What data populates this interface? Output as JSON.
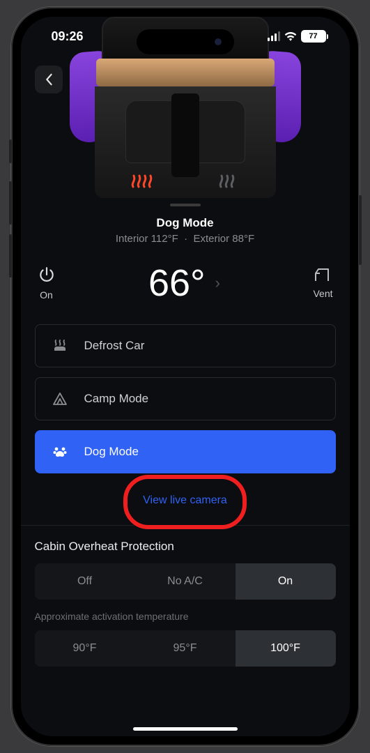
{
  "status": {
    "time": "09:26",
    "battery": "77"
  },
  "hero": {
    "mode_title": "Dog Mode",
    "interior_label": "Interior 112°F",
    "separator": "·",
    "exterior_label": "Exterior 88°F"
  },
  "controls": {
    "power_label": "On",
    "target_temp": "66°",
    "vent_label": "Vent"
  },
  "climate_items": [
    {
      "icon": "defrost",
      "label": "Defrost Car",
      "active": false
    },
    {
      "icon": "tent",
      "label": "Camp Mode",
      "active": false
    },
    {
      "icon": "paw",
      "label": "Dog Mode",
      "active": true
    }
  ],
  "live_camera_link": "View live camera",
  "cop": {
    "title": "Cabin Overheat Protection",
    "options": [
      "Off",
      "No A/C",
      "On"
    ],
    "selected": "On",
    "approx_label": "Approximate activation temperature",
    "temp_options": [
      "90°F",
      "95°F",
      "100°F"
    ],
    "temp_selected": "100°F"
  }
}
